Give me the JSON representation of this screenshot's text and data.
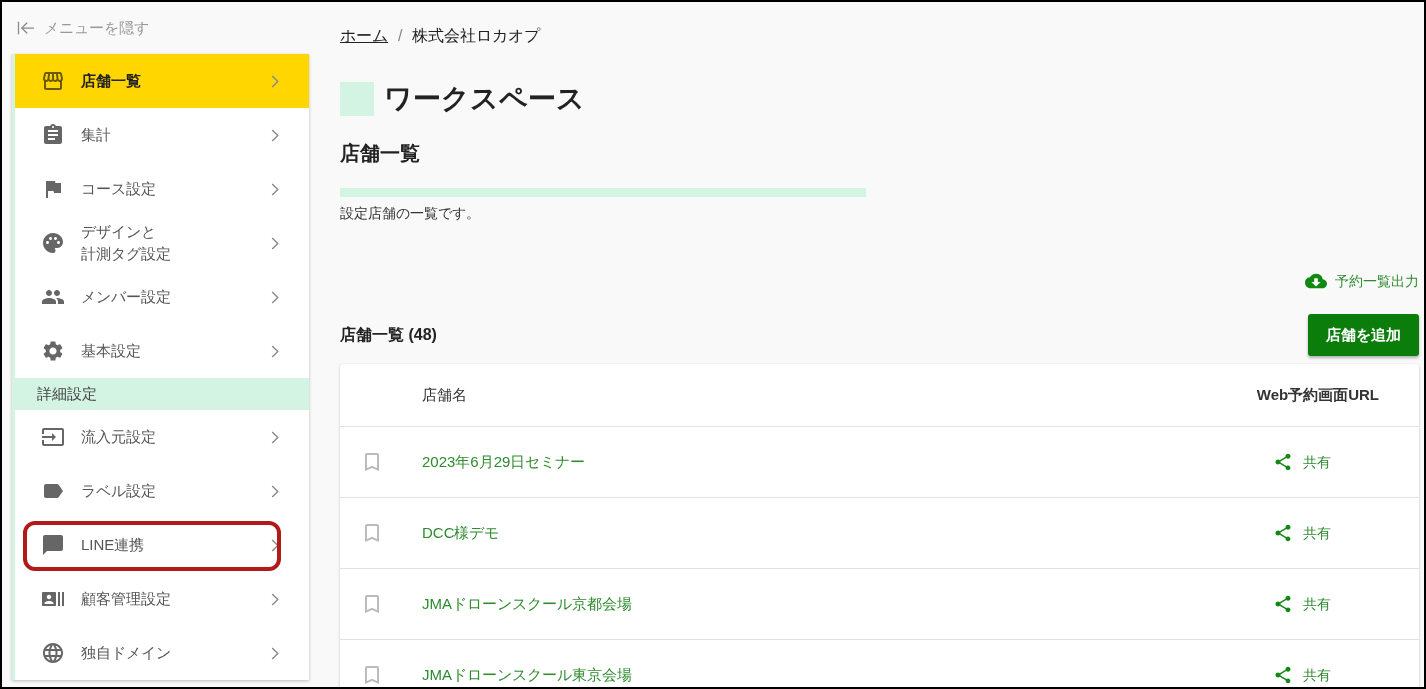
{
  "sidebar": {
    "hide_menu": "メニューを隠す",
    "items": [
      {
        "kind": "item",
        "label": "店舗一覧",
        "selected": true,
        "highlighted": false
      },
      {
        "kind": "item",
        "label": "集計",
        "selected": false,
        "highlighted": false
      },
      {
        "kind": "item",
        "label": "コース設定",
        "selected": false,
        "highlighted": false
      },
      {
        "kind": "item",
        "lines": [
          "デザインと",
          "計測タグ設定"
        ],
        "selected": false,
        "highlighted": false
      },
      {
        "kind": "item",
        "label": "メンバー設定",
        "selected": false,
        "highlighted": false
      },
      {
        "kind": "item",
        "label": "基本設定",
        "selected": false,
        "highlighted": false
      },
      {
        "kind": "section",
        "label": "詳細設定"
      },
      {
        "kind": "item",
        "label": "流入元設定",
        "selected": false,
        "highlighted": false
      },
      {
        "kind": "item",
        "label": "ラベル設定",
        "selected": false,
        "highlighted": false
      },
      {
        "kind": "item",
        "label": "LINE連携",
        "selected": false,
        "highlighted": true
      },
      {
        "kind": "item",
        "label": "顧客管理設定",
        "selected": false,
        "highlighted": false
      },
      {
        "kind": "item",
        "label": "独自ドメイン",
        "selected": false,
        "highlighted": false
      }
    ]
  },
  "breadcrumb": {
    "home": "ホーム",
    "current": "株式会社ロカオプ"
  },
  "breadcrumb_separator": "/",
  "page_title": "ワークスペース",
  "section_title": "店舗一覧",
  "description": "設定店舗の一覧です。",
  "export_link": "予約一覧出力",
  "list_title": "店舗一覧 (48)",
  "add_button": "店舗を追加",
  "table": {
    "columns": [
      "店舗名",
      "Web予約画面URL"
    ],
    "rows": [
      {
        "name": "2023年6月29日セミナー",
        "share": "共有"
      },
      {
        "name": "DCC様デモ",
        "share": "共有"
      },
      {
        "name": "JMAドローンスクール京都会場",
        "share": "共有"
      },
      {
        "name": "JMAドローンスクール東京会場",
        "share": "共有"
      }
    ]
  }
}
